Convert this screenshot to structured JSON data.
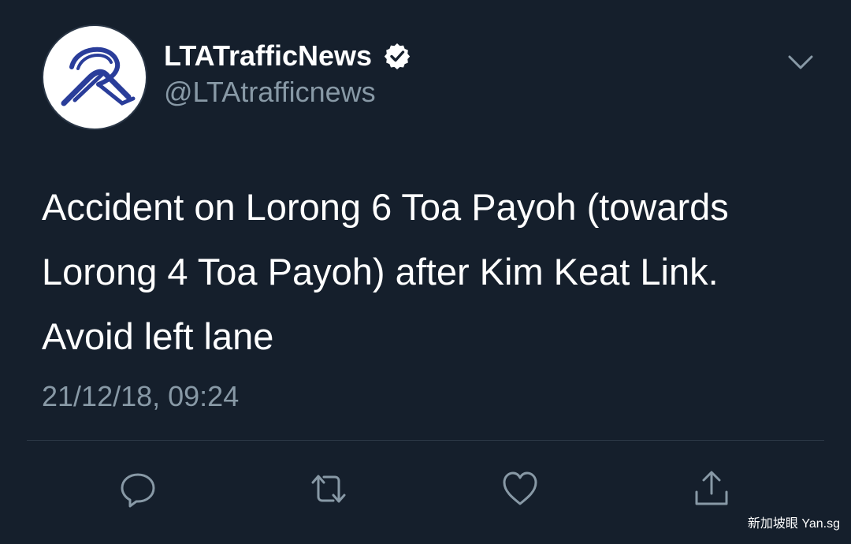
{
  "account": {
    "display_name": "LTATrafficNews",
    "handle": "@LTAtrafficnews",
    "verified": true,
    "avatar_icon": "lta-logo"
  },
  "tweet": {
    "text_lines": [
      "Accident on Lorong 6 Toa Payoh (towards",
      "Lorong 4 Toa Payoh) after Kim Keat Link.",
      "Avoid left lane"
    ],
    "timestamp": "21/12/18, 09:24"
  },
  "actions": [
    {
      "name": "reply",
      "icon": "reply-icon"
    },
    {
      "name": "retweet",
      "icon": "retweet-icon"
    },
    {
      "name": "like",
      "icon": "heart-icon"
    },
    {
      "name": "share",
      "icon": "share-icon"
    }
  ],
  "menu_icon": "chevron-down-icon",
  "watermark": "新加坡眼 Yan.sg",
  "colors": {
    "background": "#151f2c",
    "primary_text": "#ffffff",
    "secondary_text": "#8899a6",
    "logo_blue": "#2a3d9a"
  }
}
